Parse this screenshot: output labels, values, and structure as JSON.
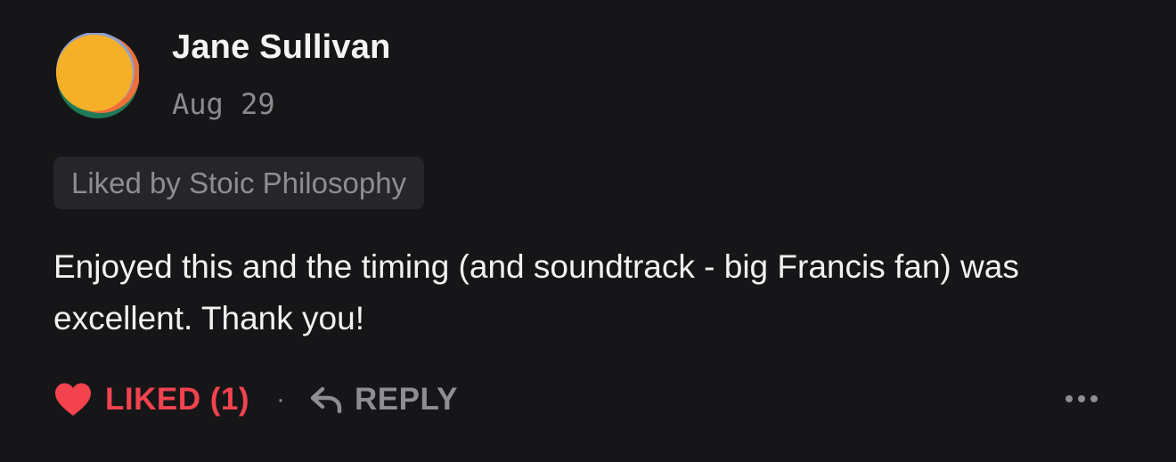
{
  "comment": {
    "author": "Jane Sullivan",
    "date": "Aug 29",
    "liked_by": "Liked by Stoic Philosophy",
    "body": "Enjoyed this and the timing (and soundtrack - big Francis fan) was excellent. Thank you!",
    "avatar_icon": "avatar-multicolor-circle",
    "actions": {
      "like_label": "LIKED (1)",
      "like_icon": "heart-filled-icon",
      "separator": "·",
      "reply_label": "REPLY",
      "reply_icon": "reply-arrow-icon",
      "more_icon": "more-horizontal-icon"
    }
  },
  "colors": {
    "background": "#161618",
    "liked_accent": "#f2434f",
    "muted_text": "#8e8e92",
    "chip_background": "#26262a"
  }
}
